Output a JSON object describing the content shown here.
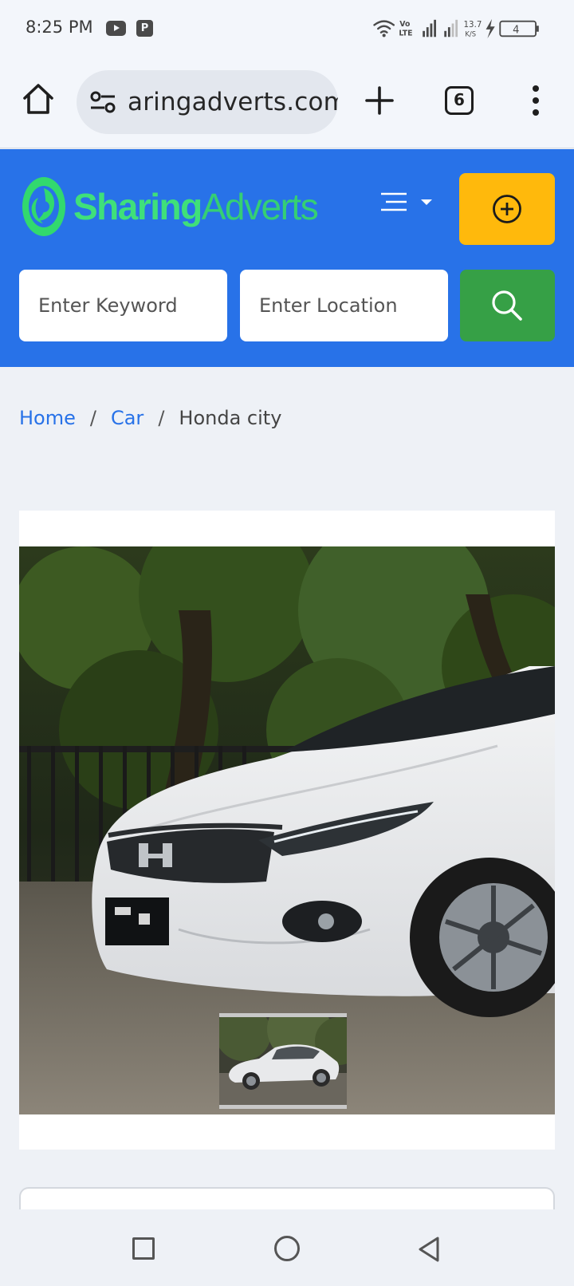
{
  "status_bar": {
    "time": "8:25 PM",
    "network_label": "Vo LTE",
    "speed_value": "13.7",
    "speed_unit": "K/S",
    "battery": "4"
  },
  "browser": {
    "url": "aringadverts.com",
    "tab_count": "6"
  },
  "site": {
    "logo_part1": "Sharing",
    "logo_part2": "Adverts",
    "brand_color": "#2872e8",
    "post_button_color": "#ffb90c",
    "search_button_color": "#36a046"
  },
  "search": {
    "keyword_placeholder": "Enter Keyword",
    "location_placeholder": "Enter Location"
  },
  "breadcrumb": {
    "items": [
      "Home",
      "Car"
    ],
    "separator": "/",
    "current": "Honda city"
  },
  "gallery": {
    "main_image_icon": "car-photo",
    "thumbnail_count": 1
  }
}
